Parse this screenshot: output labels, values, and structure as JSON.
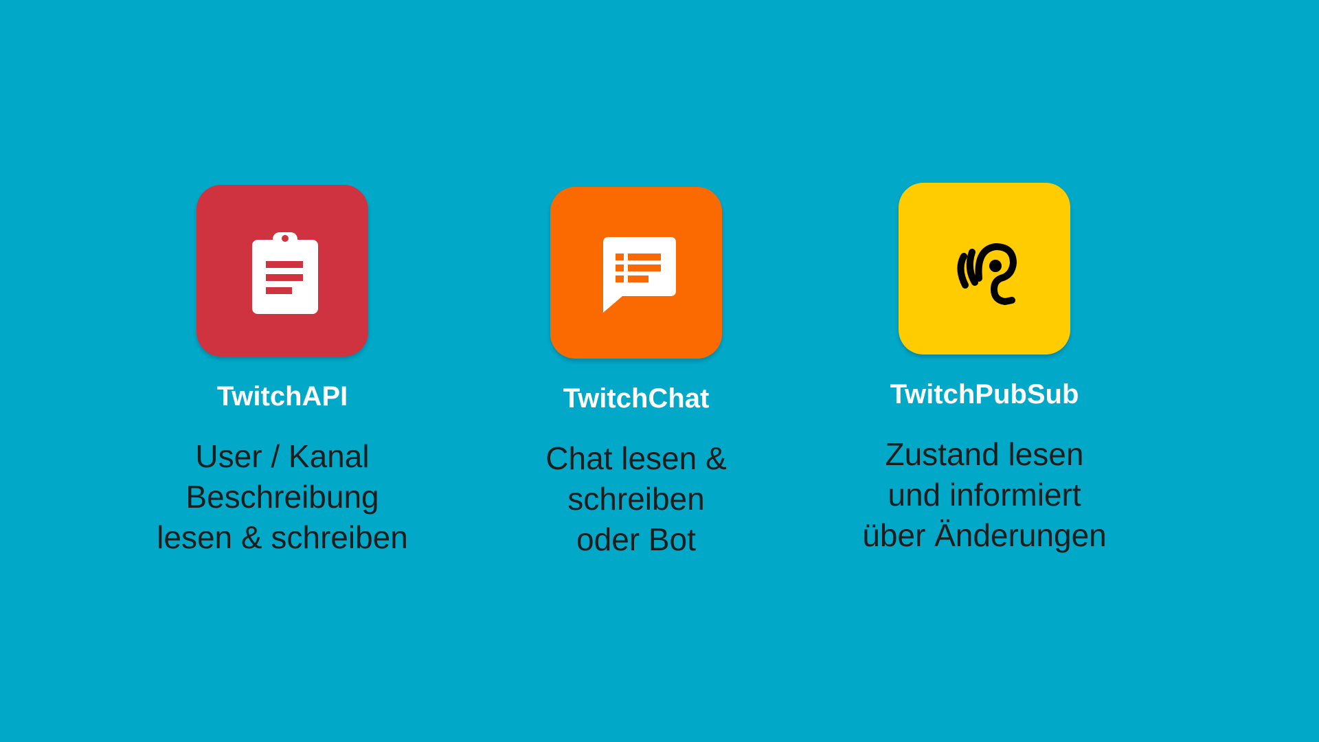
{
  "slide": {
    "background_color": "#02a8c8",
    "cards": [
      {
        "title": "TwitchAPI",
        "tile_color": "#cf3340",
        "icon": "clipboard-list-icon",
        "description": [
          "User / Kanal",
          "Beschreibung",
          "lesen & schreiben"
        ]
      },
      {
        "title": "TwitchChat",
        "tile_color": "#fb6a00",
        "icon": "chat-message-icon",
        "description": [
          "Chat lesen &",
          "schreiben",
          "oder Bot"
        ]
      },
      {
        "title": "TwitchPubSub",
        "tile_color": "#fecc00",
        "icon": "ear-listening-icon",
        "description": [
          "Zustand lesen",
          "und informiert",
          "über Änderungen"
        ]
      }
    ]
  }
}
